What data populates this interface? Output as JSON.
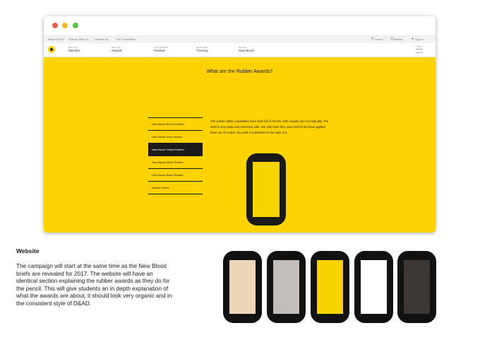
{
  "top_links": [
    "About D&AD",
    "Partner With Us",
    "Contact Us",
    "The Foundation"
  ],
  "tools": {
    "search": "Search",
    "basket": "Basket",
    "sign_in": "Sign In"
  },
  "nav": [
    {
      "small": "Become a",
      "big": "Member"
    },
    {
      "small": "Enter the",
      "big": "Awards"
    },
    {
      "small": "Good to D&AD",
      "big": "Festival"
    },
    {
      "small": "Restore with",
      "big": "Training"
    },
    {
      "small": "Discover",
      "big": "New Blood"
    }
  ],
  "menu_label": "Menu",
  "heading": "What are the Rubber Awards?",
  "rubbers": [
    "New Blood Brown Rubber",
    "New Blood Grey Rubber",
    "New Blood Yellow Rubber",
    "New Blood White Rubber",
    "New Blood Black Rubber",
    "Rubber Rules"
  ],
  "active_rubber": "New Blood Yellow Rubber",
  "description": "The yellow rubber candidates have work full of clichés, both visually and conceptually. The work is very basic and extremely safe. Not only have they used clichés but have applied them out of context, the work is submitted for the sake of it.",
  "section": {
    "title": "Website",
    "body": "The campaign will start at the same time as the New Blood briefs are revealed for 2017. The website will have an identical section explaining the rubber awards as they do for the pencil. This will give students an in depth explanation of what the awards are about, it should look very organic and in the consistent style of D&AD."
  },
  "colors": {
    "accent_yellow": "#ffd200",
    "phone_screens": [
      "#eed7b8",
      "#c1bdbb",
      "#f8d400",
      "#ffffff",
      "#3b3735"
    ],
    "big_phone_screen": "#f8d400"
  }
}
